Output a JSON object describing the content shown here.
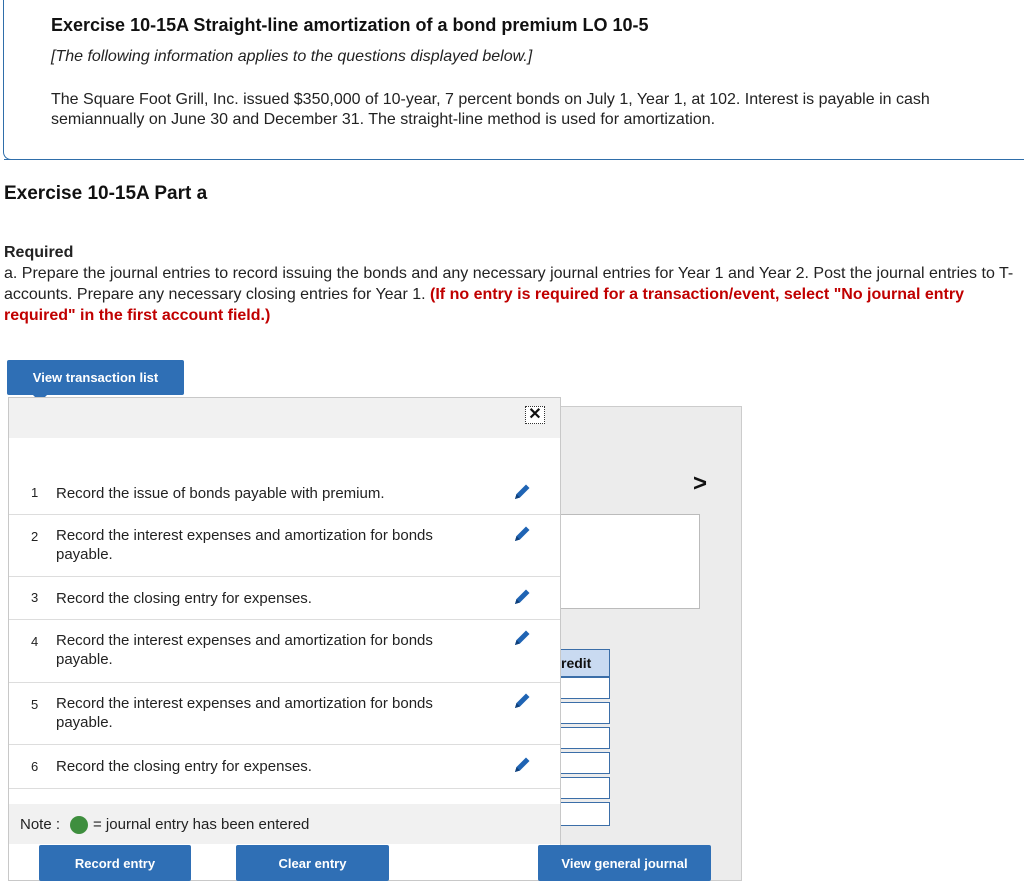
{
  "header": {
    "exercise_title": "Exercise 10-15A Straight-line amortization of a bond premium LO 10-5",
    "info_note": "[The following information applies to the questions displayed below.]",
    "problem_text": "The Square Foot Grill, Inc. issued $350,000 of 10-year, 7 percent bonds on July 1, Year 1, at 102. Interest is payable in cash semiannually on June 30 and December 31. The straight-line method is used for amortization."
  },
  "part_title": "Exercise 10-15A Part a",
  "required": {
    "heading": "Required",
    "text": "a. Prepare the journal entries to record issuing the bonds and any necessary journal entries for Year 1 and Year 2. Post the journal entries to T-accounts. Prepare any necessary closing entries for Year 1.",
    "instruction": "(If no entry is required for a transaction/event, select \"No journal entry required\" in the first account field.)"
  },
  "buttons": {
    "view_transaction_list": "View transaction list",
    "record_entry": "Record entry",
    "clear_entry": "Clear entry",
    "view_general_journal": "View general journal"
  },
  "transactions": [
    {
      "num": "1",
      "text": "Record the issue of bonds payable with premium."
    },
    {
      "num": "2",
      "text": "Record the interest expenses and amortization for bonds payable."
    },
    {
      "num": "3",
      "text": "Record the closing entry for expenses."
    },
    {
      "num": "4",
      "text": "Record the interest expenses and amortization for bonds payable."
    },
    {
      "num": "5",
      "text": "Record the interest expenses and amortization for bonds payable."
    },
    {
      "num": "6",
      "text": "Record the closing entry for expenses."
    }
  ],
  "note": {
    "label": "Note :",
    "description": "= journal entry has been entered",
    "dot_color": "#3e8e3e"
  },
  "journal": {
    "credit_header_partial": "redit"
  },
  "icons": {
    "close": "close-icon",
    "edit": "pencil-icon",
    "next": "chevron-right-icon",
    "next_glyph": ">",
    "close_glyph": "✕"
  },
  "colors": {
    "accent": "#2f6fb5",
    "required_red": "#c00000"
  }
}
